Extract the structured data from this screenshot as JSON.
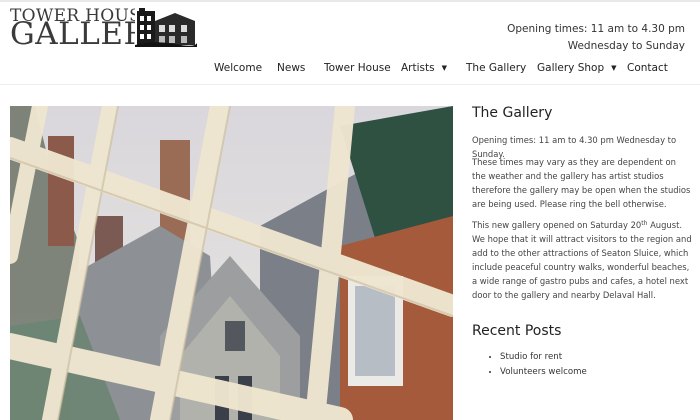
{
  "site": {
    "logo_line1": "Tower House",
    "logo_line2": "Gallery"
  },
  "header": {
    "hours_line1": "Opening times: 11 am to 4.30 pm",
    "hours_line2": "Wednesday to Sunday"
  },
  "nav": {
    "items": [
      {
        "label": "Welcome"
      },
      {
        "label": "News"
      },
      {
        "label": "Tower House"
      },
      {
        "label": "Artists",
        "dropdown": true
      },
      {
        "label": "The Gallery"
      },
      {
        "label": "Gallery Shop",
        "dropdown": true
      },
      {
        "label": "Contact"
      }
    ]
  },
  "sidebar": {
    "title": "The Gallery",
    "p1": "Opening times: 11 am to 4.30 pm Wednesday to Sunday.",
    "p2": "These times may vary as they are dependent on the weather and the gallery has artist studios therefore the gallery may be open when the studios are being used. Please ring the bell otherwise.",
    "p3_before": "This new gallery opened on Saturday 20",
    "p3_sup": "th",
    "p3_after": " August. We hope that it will attract visitors to the region and add to the other attractions of Seaton Sluice, which include peaceful country walks, wonderful beaches, a wide range of gastro pubs and cafes, a hotel next door to the gallery and nearby Delaval Hall.",
    "recent_title": "Recent Posts",
    "posts": [
      "Studio for rent",
      "Volunteers welcome"
    ]
  },
  "icons": {
    "dropdown": "caret-down-icon"
  }
}
